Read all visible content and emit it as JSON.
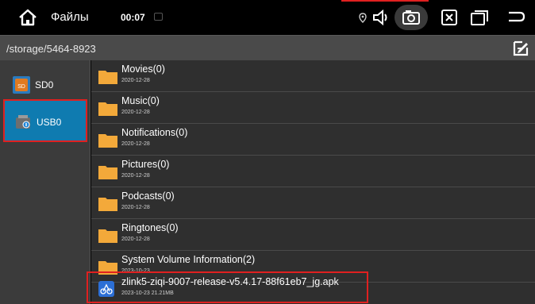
{
  "statusbar": {
    "app_title": "Файлы",
    "time": "00:07",
    "icons": [
      "home-icon",
      "location-icon",
      "volume-icon",
      "screenshot-icon",
      "close-window-icon",
      "recent-apps-icon",
      "back-icon"
    ]
  },
  "path": {
    "current": "/storage/5464-8923"
  },
  "sidebar": {
    "items": [
      {
        "label": "SD0",
        "icon": "sd-card-icon",
        "selected": false
      },
      {
        "label": "USB0",
        "icon": "usb-drive-icon",
        "selected": true
      }
    ]
  },
  "files": [
    {
      "name": "Movies(0)",
      "meta": "2020-12-28",
      "type": "folder"
    },
    {
      "name": "Music(0)",
      "meta": "2020-12-28",
      "type": "folder"
    },
    {
      "name": "Notifications(0)",
      "meta": "2020-12-28",
      "type": "folder"
    },
    {
      "name": "Pictures(0)",
      "meta": "2020-12-28",
      "type": "folder"
    },
    {
      "name": "Podcasts(0)",
      "meta": "2020-12-28",
      "type": "folder"
    },
    {
      "name": "Ringtones(0)",
      "meta": "2020-12-28",
      "type": "folder"
    },
    {
      "name": "System Volume Information(2)",
      "meta": "2023-10-23",
      "type": "folder"
    },
    {
      "name": "zlink5-ziqi-9007-release-v5.4.17-88f61eb7_jg.apk",
      "meta": "2023-10-23 21.21MB",
      "type": "apk"
    }
  ],
  "colors": {
    "accent": "#0f7bb0",
    "folder": "#f3a93a",
    "highlight": "#e02020"
  }
}
